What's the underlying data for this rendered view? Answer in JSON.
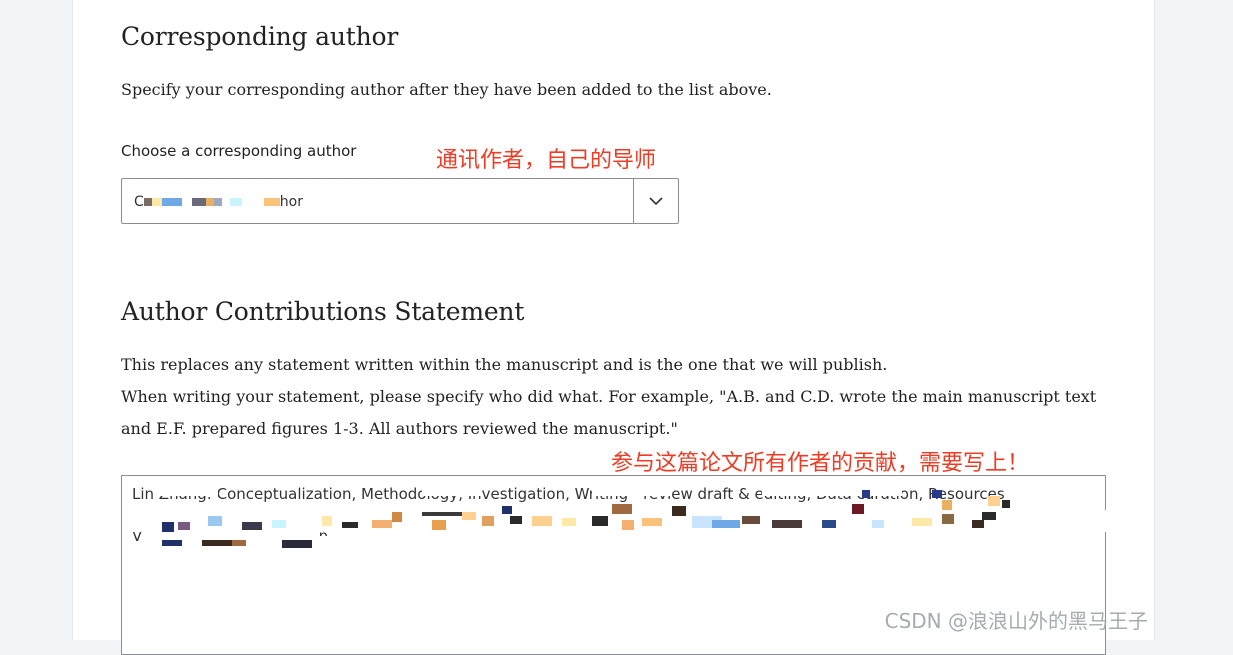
{
  "corresponding": {
    "heading": "Corresponding author",
    "description": "Specify your corresponding author after they have been added to the list above.",
    "select_label": "Choose a corresponding author",
    "select_value": "C",
    "select_value_tail": "hor",
    "annotation": "通讯作者，自己的导师"
  },
  "contributions": {
    "heading": "Author Contributions Statement",
    "line1": "This replaces any statement written within the manuscript and is the one that we will publish.",
    "line2": "When writing your statement, please specify who did what. For example, \"A.B. and C.D. wrote the main manuscript text",
    "line3": "and E.F. prepared figures 1-3. All authors reviewed the manuscript.\"",
    "annotation": "参与这篇论文所有作者的贡献，需要写上！",
    "textarea_line1": "Lin Zhang: Conceptualization, Methodology, Investigation, Writing - review draft & editing, Data curation, Resources",
    "textarea_line2": "",
    "textarea_line3": "V                                     n."
  },
  "colors": {
    "annotation": "#ef3b24",
    "text": "#222222",
    "border": "#8a8d91"
  },
  "icons": {
    "dropdown": "chevron-down-icon"
  },
  "watermark": "CSDN @浪浪山外的黑马王子"
}
